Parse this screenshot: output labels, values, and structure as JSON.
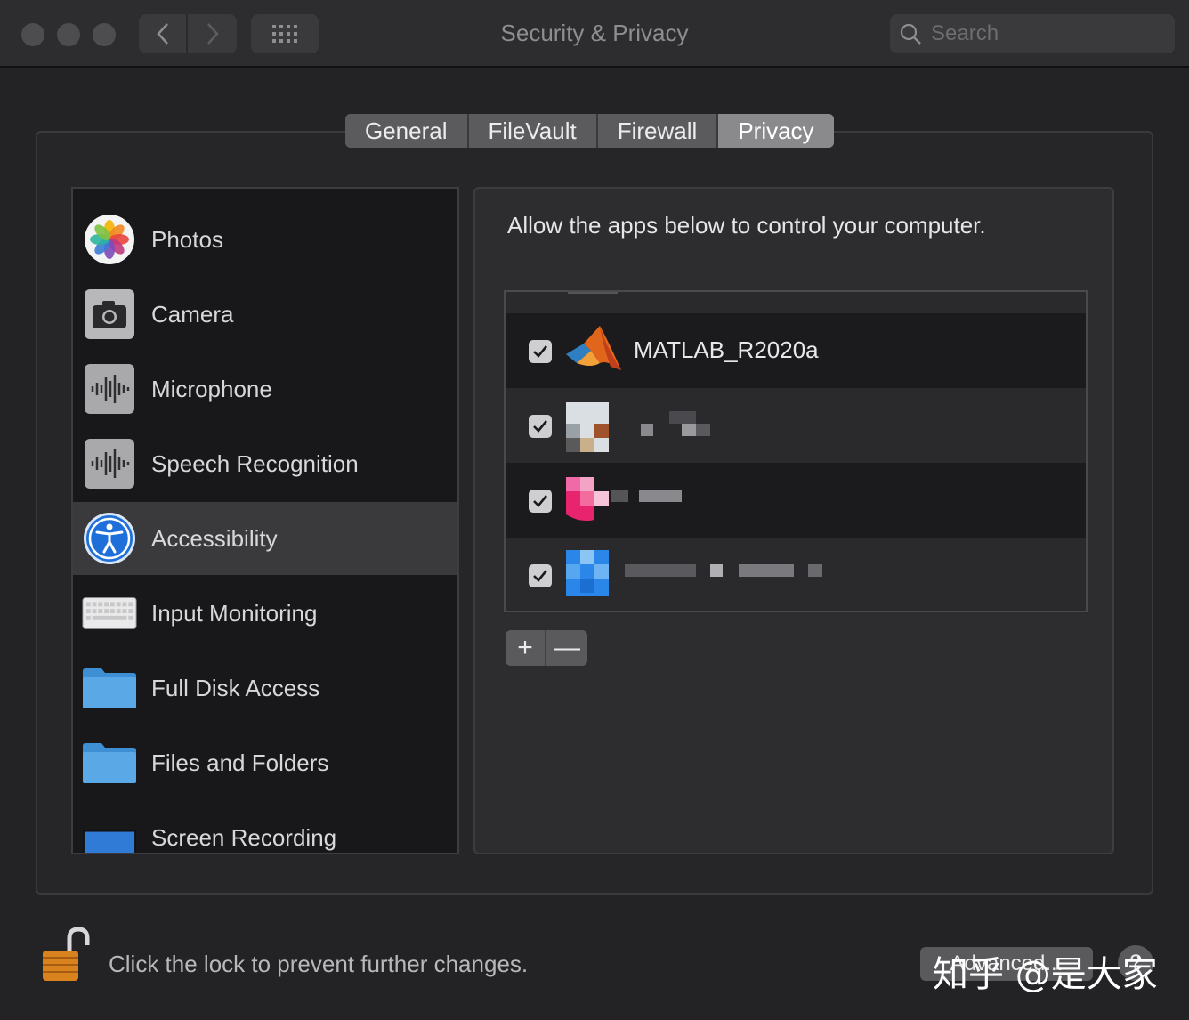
{
  "window": {
    "title": "Security & Privacy"
  },
  "search": {
    "placeholder": "Search"
  },
  "tabs": [
    {
      "label": "General"
    },
    {
      "label": "FileVault"
    },
    {
      "label": "Firewall"
    },
    {
      "label": "Privacy",
      "active": true
    }
  ],
  "sidebar": {
    "items": [
      {
        "label": "Photos",
        "icon": "photos-icon"
      },
      {
        "label": "Camera",
        "icon": "camera-icon"
      },
      {
        "label": "Microphone",
        "icon": "microphone-icon"
      },
      {
        "label": "Speech Recognition",
        "icon": "speech-recognition-icon"
      },
      {
        "label": "Accessibility",
        "icon": "accessibility-icon",
        "selected": true
      },
      {
        "label": "Input Monitoring",
        "icon": "keyboard-icon"
      },
      {
        "label": "Full Disk Access",
        "icon": "folder-icon"
      },
      {
        "label": "Files and Folders",
        "icon": "folder-icon"
      },
      {
        "label": "Screen Recording",
        "icon": "screen-recording-icon"
      }
    ]
  },
  "main": {
    "heading": "Allow the apps below to control your computer.",
    "apps": [
      {
        "name": "MATLAB_R2020a",
        "checked": true,
        "icon": "matlab-icon"
      },
      {
        "name": "",
        "checked": true,
        "icon": "blurred-app-icon"
      },
      {
        "name": "",
        "checked": true,
        "icon": "blurred-app-icon"
      },
      {
        "name": "",
        "checked": true,
        "icon": "blurred-app-icon"
      }
    ],
    "add_label": "+",
    "remove_label": "—"
  },
  "footer": {
    "lock_text": "Click the lock to prevent further changes.",
    "advanced_label": "Advanced...",
    "help_label": "?",
    "watermark": "知乎 @是大家"
  },
  "colors": {
    "accessibility_blue": "#1e6fd9",
    "folder_blue": "#5aa9e6",
    "matlab_orange": "#e2651c"
  }
}
